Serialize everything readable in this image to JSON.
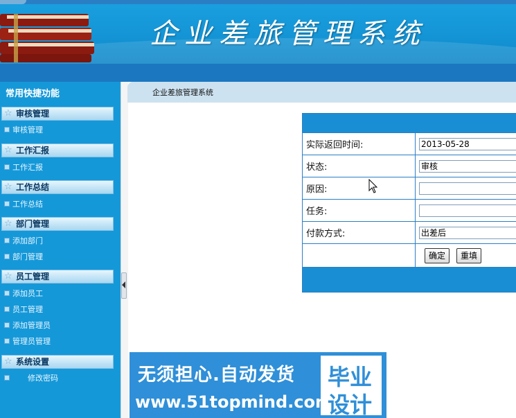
{
  "header": {
    "title": "企业差旅管理系统"
  },
  "sidebar": {
    "title": "常用快捷功能",
    "groups": [
      {
        "label": "审核管理",
        "items": [
          "审核管理"
        ]
      },
      {
        "label": "工作汇报",
        "items": [
          "工作汇报"
        ]
      },
      {
        "label": "工作总结",
        "items": [
          "工作总结"
        ]
      },
      {
        "label": "部门管理",
        "items": [
          "添加部门",
          "部门管理"
        ]
      },
      {
        "label": "员工管理",
        "items": [
          "添加员工",
          "员工管理",
          "添加管理员",
          "管理员管理"
        ]
      },
      {
        "label": "系统设置",
        "items": [
          "修改密码"
        ]
      }
    ]
  },
  "content": {
    "breadcrumb": "企业差旅管理系统",
    "form": {
      "fields": [
        {
          "label": "实际返回时间:",
          "value": "2013-05-28"
        },
        {
          "label": "状态:",
          "value": "审核"
        },
        {
          "label": "原因:",
          "value": ""
        },
        {
          "label": "任务:",
          "value": ""
        },
        {
          "label": "付款方式:",
          "value": "出差后"
        }
      ],
      "submit_label": "确定",
      "reset_label": "重填"
    }
  },
  "watermark": {
    "line1": "无须担心.自动发货",
    "line2": "www.51topmind.com",
    "badge_top": "毕业",
    "badge_bottom": "设计"
  }
}
